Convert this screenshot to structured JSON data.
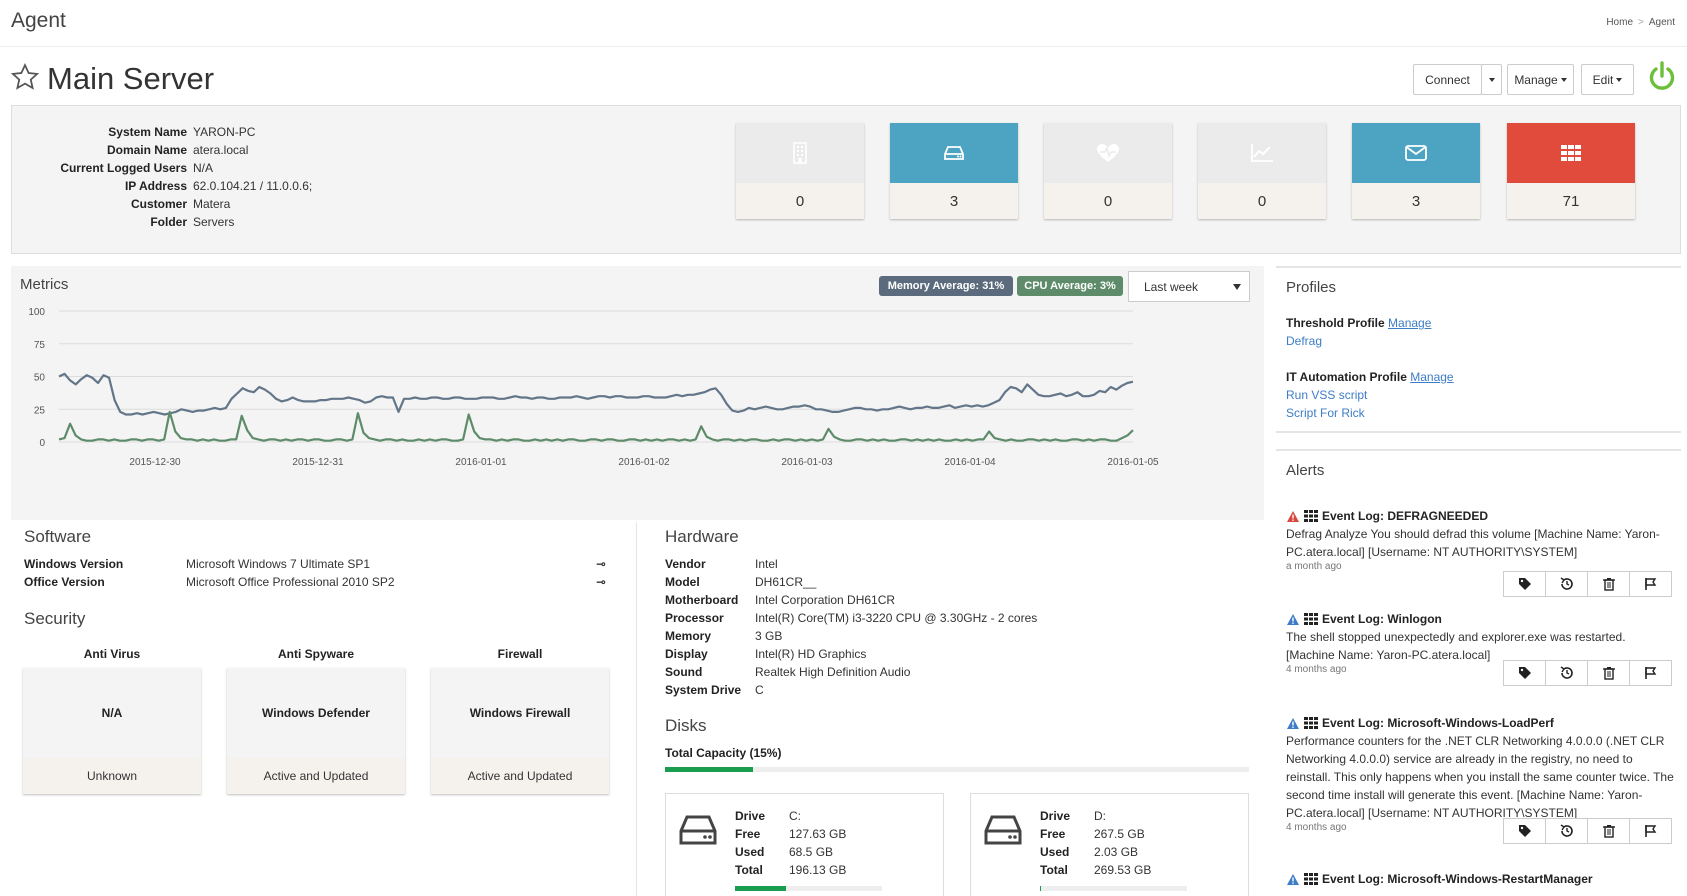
{
  "header": {
    "title": "Agent",
    "breadcrumb": [
      "Home",
      "Agent"
    ]
  },
  "page": {
    "title": "Main Server",
    "buttons": {
      "connect": "Connect",
      "manage": "Manage",
      "edit": "Edit"
    }
  },
  "system_info": [
    {
      "key": "System Name",
      "value": "YARON-PC"
    },
    {
      "key": "Domain Name",
      "value": "atera.local"
    },
    {
      "key": "Current Logged Users",
      "value": "N/A"
    },
    {
      "key": "IP Address",
      "value": "62.0.104.21 / 11.0.0.6;"
    },
    {
      "key": "Customer",
      "value": "Matera"
    },
    {
      "key": "Folder",
      "value": "Servers"
    }
  ],
  "tiles": [
    {
      "icon": "building-icon",
      "count": "0",
      "color": "#ebebeb"
    },
    {
      "icon": "hard-drive-icon",
      "count": "3",
      "color": "#4da4c2"
    },
    {
      "icon": "heartbeat-icon",
      "count": "0",
      "color": "#ebebeb"
    },
    {
      "icon": "line-chart-icon",
      "count": "0",
      "color": "#ebebeb"
    },
    {
      "icon": "envelope-icon",
      "count": "3",
      "color": "#4da4c2"
    },
    {
      "icon": "grid-icon",
      "count": "71",
      "color": "#e14b3b"
    }
  ],
  "metrics": {
    "title": "Metrics",
    "memory_badge": "Memory Average: 31%",
    "cpu_badge": "CPU Average: 3%",
    "range": "Last week"
  },
  "chart_data": {
    "type": "line",
    "title": "",
    "ylim": [
      0,
      100
    ],
    "yticks": [
      "100",
      "75",
      "50",
      "25",
      "0"
    ],
    "xticks": [
      "2015-12-30",
      "2015-12-31",
      "2016-01-01",
      "2016-01-02",
      "2016-01-03",
      "2016-01-04",
      "2016-01-05"
    ],
    "series": [
      {
        "name": "Memory Average: 31%",
        "color": "#637689",
        "values": [
          50,
          52,
          47,
          44,
          48,
          51,
          49,
          45,
          51,
          49,
          32,
          23,
          21,
          21,
          22,
          21,
          22,
          23,
          22,
          21,
          22,
          23,
          25,
          24,
          23,
          24,
          24,
          25,
          26,
          25,
          26,
          33,
          37,
          41,
          39,
          38,
          42,
          40,
          37,
          33,
          31,
          32,
          34,
          32,
          31,
          31,
          31,
          32,
          32,
          33,
          33,
          33,
          34,
          33,
          32,
          30,
          31,
          34,
          35,
          34,
          34,
          23,
          33,
          33,
          34,
          33,
          33,
          34,
          34,
          33,
          33,
          34,
          34,
          33,
          33,
          33,
          34,
          34,
          34,
          33,
          33,
          34,
          35,
          34,
          34,
          33,
          34,
          34,
          33,
          33,
          34,
          34,
          34,
          35,
          34,
          33,
          34,
          35,
          35,
          34,
          35,
          35,
          34,
          34,
          34,
          35,
          35,
          34,
          34,
          34,
          35,
          36,
          35,
          36,
          36,
          37,
          38,
          40,
          41,
          36,
          29,
          24,
          23,
          24,
          26,
          25,
          26,
          27,
          26,
          25,
          25,
          26,
          27,
          27,
          28,
          27,
          25,
          25,
          24,
          23,
          23,
          24,
          25,
          26,
          26,
          25,
          25,
          24,
          25,
          25,
          26,
          27,
          26,
          25,
          26,
          26,
          27,
          26,
          26,
          27,
          28,
          26,
          27,
          28,
          27,
          28,
          27,
          28,
          30,
          32,
          38,
          42,
          41,
          38,
          44,
          40,
          36,
          35,
          35,
          36,
          37,
          35,
          36,
          38,
          35,
          35,
          36,
          39,
          38,
          42,
          40,
          43,
          45,
          46
        ]
      },
      {
        "name": "CPU Average: 3%",
        "color": "#5e8c6a",
        "values": [
          2,
          3,
          14,
          5,
          2,
          1,
          1,
          2,
          2,
          1,
          2,
          1,
          1,
          2,
          2,
          1,
          2,
          2,
          1,
          2,
          23,
          8,
          3,
          2,
          2,
          1,
          2,
          1,
          2,
          1,
          1,
          2,
          2,
          20,
          9,
          3,
          2,
          1,
          2,
          2,
          1,
          2,
          1,
          2,
          2,
          1,
          2,
          2,
          1,
          1,
          2,
          2,
          1,
          2,
          22,
          7,
          3,
          2,
          1,
          2,
          2,
          1,
          2,
          1,
          1,
          2,
          1,
          2,
          1,
          2,
          2,
          1,
          1,
          2,
          21,
          8,
          3,
          2,
          2,
          1,
          2,
          1,
          2,
          2,
          1,
          1,
          2,
          1,
          2,
          1,
          2,
          1,
          2,
          2,
          1,
          1,
          2,
          2,
          1,
          2,
          2,
          1,
          1,
          2,
          2,
          1,
          2,
          1,
          2,
          1,
          2,
          2,
          1,
          2,
          1,
          2,
          12,
          4,
          2,
          1,
          2,
          2,
          1,
          2,
          1,
          2,
          2,
          1,
          1,
          2,
          1,
          2,
          2,
          1,
          2,
          1,
          2,
          1,
          2,
          10,
          4,
          2,
          1,
          1,
          2,
          2,
          1,
          2,
          1,
          2,
          1,
          1,
          2,
          2,
          1,
          2,
          1,
          2,
          1,
          2,
          1,
          1,
          2,
          1,
          2,
          1,
          2,
          2,
          8,
          3,
          2,
          1,
          2,
          1,
          1,
          2,
          2,
          1,
          2,
          1,
          2,
          1,
          1,
          2,
          2,
          1,
          2,
          1,
          2,
          2,
          1,
          1,
          3,
          5,
          9
        ]
      }
    ]
  },
  "software": {
    "title": "Software",
    "rows": [
      {
        "key": "Windows Version",
        "value": "Microsoft Windows 7 Ultimate SP1",
        "icon": "key-icon"
      },
      {
        "key": "Office Version",
        "value": "Microsoft Office Professional 2010 SP2",
        "icon": "key-icon"
      }
    ]
  },
  "security": {
    "title": "Security",
    "cards": [
      {
        "label": "Anti Virus",
        "value": "N/A",
        "status": "Unknown"
      },
      {
        "label": "Anti Spyware",
        "value": "Windows Defender",
        "status": "Active and Updated"
      },
      {
        "label": "Firewall",
        "value": "Windows Firewall",
        "status": "Active and Updated"
      }
    ]
  },
  "hardware": {
    "title": "Hardware",
    "rows": [
      {
        "key": "Vendor",
        "value": "Intel"
      },
      {
        "key": "Model",
        "value": "DH61CR__"
      },
      {
        "key": "Motherboard",
        "value": "Intel Corporation DH61CR"
      },
      {
        "key": "Processor",
        "value": "Intel(R) Core(TM) i3-3220 CPU @ 3.30GHz - 2 cores"
      },
      {
        "key": "Memory",
        "value": "3 GB"
      },
      {
        "key": "Display",
        "value": "Intel(R) HD Graphics"
      },
      {
        "key": "Sound",
        "value": "Realtek High Definition Audio"
      },
      {
        "key": "System Drive",
        "value": "C"
      }
    ]
  },
  "disks": {
    "title": "Disks",
    "total_label": "Total Capacity (15%)",
    "total_percent": 15,
    "items": [
      {
        "drive_label": "Drive",
        "drive": "C:",
        "free_label": "Free",
        "free": "127.63 GB",
        "used_label": "Used",
        "used": "68.5 GB",
        "total_label": "Total",
        "total": "196.13 GB",
        "used_percent": 35
      },
      {
        "drive_label": "Drive",
        "drive": "D:",
        "free_label": "Free",
        "free": "267.5 GB",
        "used_label": "Used",
        "used": "2.03 GB",
        "total_label": "Total",
        "total": "269.53 GB",
        "used_percent": 1
      }
    ]
  },
  "profiles": {
    "title": "Profiles",
    "threshold_label": "Threshold Profile",
    "threshold_manage": "Manage",
    "threshold_items": [
      "Defrag"
    ],
    "automation_label": "IT Automation Profile",
    "automation_manage": "Manage",
    "automation_items": [
      "Run VSS script",
      "Script For Rick"
    ]
  },
  "alerts": {
    "title": "Alerts",
    "items": [
      {
        "severity": "critical",
        "title": "Event Log: DEFRAGNEEDED",
        "message": "Defrag Analyze You should defrad this volume [Machine Name: Yaron-PC.atera.local] [Username: NT AUTHORITY\\SYSTEM]",
        "time": "a month ago"
      },
      {
        "severity": "warning",
        "title": "Event Log: Winlogon",
        "message": "The shell stopped unexpectedly and explorer.exe was restarted. [Machine Name: Yaron-PC.atera.local]",
        "time": "4 months ago"
      },
      {
        "severity": "warning",
        "title": "Event Log: Microsoft-Windows-LoadPerf",
        "message": "Performance counters for the .NET CLR Networking 4.0.0.0 (.NET CLR Networking 4.0.0.0) service are already in the registry, no need to reinstall. This only happens when you install the same counter twice. The second time install will generate this event. [Machine Name: Yaron-PC.atera.local] [Username: NT AUTHORITY\\SYSTEM]",
        "time": "4 months ago"
      },
      {
        "severity": "warning",
        "title": "Event Log: Microsoft-Windows-RestartManager",
        "message": "",
        "time": ""
      }
    ]
  }
}
